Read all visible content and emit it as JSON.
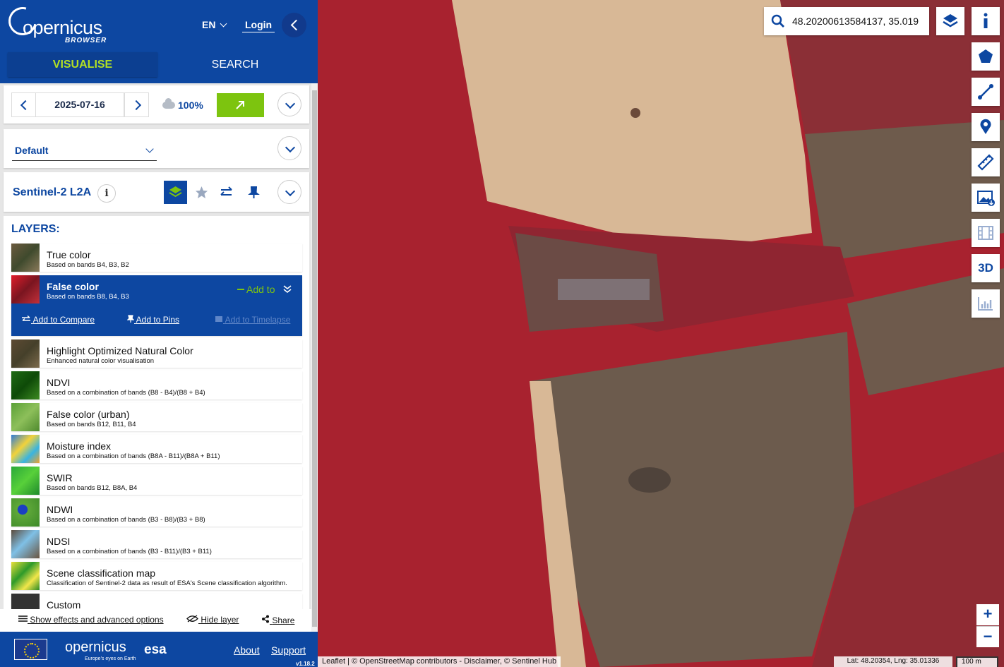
{
  "header": {
    "logo_text": "opernicus",
    "logo_sub": "BROWSER",
    "language": "EN",
    "login": "Login",
    "tabs": [
      "VISUALISE",
      "SEARCH"
    ]
  },
  "date_bar": {
    "date": "2025-07-16",
    "cloud_coverage": "100%"
  },
  "theme": {
    "selected": "Default"
  },
  "collection": {
    "name": "Sentinel-2 L2A",
    "info": "i"
  },
  "layers": {
    "title": "LAYERS:",
    "items": [
      {
        "name": "True color",
        "desc": "Based on bands B4, B3, B2"
      },
      {
        "name": "False color",
        "desc": "Based on bands B8, B4, B3"
      },
      {
        "name": "Highlight Optimized Natural Color",
        "desc": "Enhanced natural color visualisation"
      },
      {
        "name": "NDVI",
        "desc": "Based on a combination of bands (B8 - B4)/(B8 + B4)"
      },
      {
        "name": "False color (urban)",
        "desc": "Based on bands B12, B11, B4"
      },
      {
        "name": "Moisture index",
        "desc": "Based on a combination of bands (B8A - B11)/(B8A + B11)"
      },
      {
        "name": "SWIR",
        "desc": "Based on bands B12, B8A, B4"
      },
      {
        "name": "NDWI",
        "desc": "Based on a combination of bands (B3 - B8)/(B3 + B8)"
      },
      {
        "name": "NDSI",
        "desc": "Based on a combination of bands (B3 - B11)/(B3 + B11)"
      },
      {
        "name": "Scene classification map",
        "desc": "Classification of Sentinel-2 data as result of ESA's Scene classification algorithm."
      },
      {
        "name": "Custom",
        "desc": ""
      }
    ],
    "selected_actions": {
      "add_to": "Add to",
      "add_to_compare": "Add to Compare",
      "add_to_pins": "Add to Pins",
      "add_to_timelapse": "Add to Timelapse"
    }
  },
  "bottom_options": {
    "effects": "Show effects and advanced options",
    "hide": "Hide layer",
    "share": "Share"
  },
  "footer": {
    "copernicus": "opernicus",
    "copernicus_sub": "Europe's eyes on Earth",
    "esa": "esa",
    "about": "About",
    "support": "Support",
    "version": "v1.18.2"
  },
  "map": {
    "search_value": "48.20200613584137, 35.019",
    "three_d": "3D",
    "zoom_in": "+",
    "zoom_out": "−",
    "attribution": "Leaflet | © OpenStreetMap contributors - Disclaimer, © Sentinel Hub",
    "latlng": "Lat: 48.20354, Lng: 35.01336",
    "scale": "100 m"
  },
  "colors": {
    "brand_blue": "#0d47a1",
    "accent_green": "#7dc40f"
  }
}
